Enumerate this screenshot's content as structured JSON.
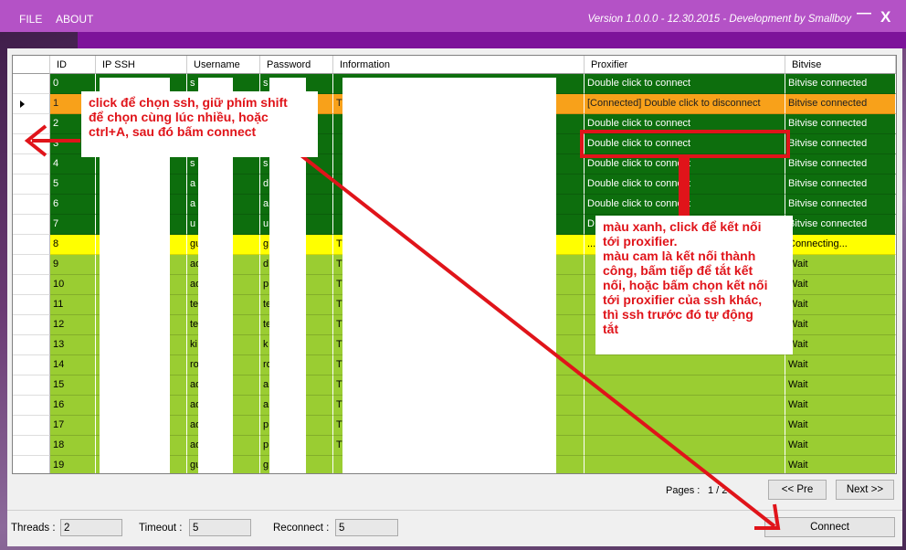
{
  "menu": {
    "file": "FILE",
    "about": "ABOUT"
  },
  "title": {
    "version": "Version 1.0.0.0 - 12.30.2015 - Development by Smallboy",
    "minimize": "—",
    "close": "X"
  },
  "grid": {
    "columns": [
      "ID",
      "IP SSH",
      "Username",
      "Password",
      "Information",
      "Proxifier",
      "Bitvise"
    ],
    "rows": [
      {
        "id": "0",
        "user": "s",
        "pass": "s",
        "info": "",
        "proxifier": "Double click to connect",
        "bitvise": "Bitvise connected",
        "color": "#0d6e0d",
        "fg": "#ffffff"
      },
      {
        "id": "1",
        "user": "",
        "pass": "",
        "info": "T",
        "proxifier": "[Connected] Double click to disconnect",
        "bitvise": "Bitvise connected",
        "color": "#f8a11a",
        "fg": "#202020"
      },
      {
        "id": "2",
        "user": "",
        "pass": "",
        "info": "",
        "proxifier": "Double click to connect",
        "bitvise": "Bitvise connected",
        "color": "#0d6e0d",
        "fg": "#ffffff"
      },
      {
        "id": "3",
        "user": "",
        "pass": "",
        "info": "",
        "proxifier": "Double click to connect",
        "bitvise": "Bitvise connected",
        "color": "#0d6e0d",
        "fg": "#ffffff"
      },
      {
        "id": "4",
        "user": "s",
        "pass": "s",
        "info": "",
        "proxifier": "Double click to connect",
        "bitvise": "Bitvise connected",
        "color": "#0d6e0d",
        "fg": "#ffffff"
      },
      {
        "id": "5",
        "user": "a",
        "pass": "d",
        "info": "",
        "proxifier": "Double click to connect",
        "bitvise": "Bitvise connected",
        "color": "#0d6e0d",
        "fg": "#ffffff"
      },
      {
        "id": "6",
        "user": "a",
        "pass": "a",
        "info": "",
        "proxifier": "Double click to connect",
        "bitvise": "Bitvise connected",
        "color": "#0d6e0d",
        "fg": "#ffffff"
      },
      {
        "id": "7",
        "user": "u",
        "pass": "u",
        "info": "",
        "proxifier": "D",
        "bitvise": "Bitvise connected",
        "color": "#0d6e0d",
        "fg": "#ffffff"
      },
      {
        "id": "8",
        "user": "gu",
        "pass": "g",
        "info": "T",
        "proxifier": "...",
        "bitvise": "Connecting...",
        "color": "#ffff00",
        "fg": "#000000"
      },
      {
        "id": "9",
        "user": "ad",
        "pass": "d",
        "info": "T",
        "proxifier": "",
        "bitvise": "Wait",
        "color": "#9acd32",
        "fg": "#000000"
      },
      {
        "id": "10",
        "user": "ad",
        "pass": "p",
        "info": "T",
        "proxifier": "",
        "bitvise": "Wait",
        "color": "#9acd32",
        "fg": "#000000"
      },
      {
        "id": "11",
        "user": "te",
        "pass": "te",
        "info": "T",
        "proxifier": "",
        "bitvise": "Wait",
        "color": "#9acd32",
        "fg": "#000000"
      },
      {
        "id": "12",
        "user": "te",
        "pass": "te",
        "info": "T",
        "proxifier": "",
        "bitvise": "Wait",
        "color": "#9acd32",
        "fg": "#000000"
      },
      {
        "id": "13",
        "user": "ki",
        "pass": "k",
        "info": "T",
        "proxifier": "",
        "bitvise": "Wait",
        "color": "#9acd32",
        "fg": "#000000"
      },
      {
        "id": "14",
        "user": "ro",
        "pass": "ro",
        "info": "T",
        "proxifier": "",
        "bitvise": "Wait",
        "color": "#9acd32",
        "fg": "#000000"
      },
      {
        "id": "15",
        "user": "ad",
        "pass": "a",
        "info": "T",
        "proxifier": "",
        "bitvise": "Wait",
        "color": "#9acd32",
        "fg": "#000000"
      },
      {
        "id": "16",
        "user": "ad",
        "pass": "a",
        "info": "T",
        "proxifier": "",
        "bitvise": "Wait",
        "color": "#9acd32",
        "fg": "#000000"
      },
      {
        "id": "17",
        "user": "ad",
        "pass": "p",
        "info": "T",
        "proxifier": "",
        "bitvise": "Wait",
        "color": "#9acd32",
        "fg": "#000000"
      },
      {
        "id": "18",
        "user": "ad",
        "pass": "p",
        "info": "T",
        "proxifier": "",
        "bitvise": "Wait",
        "color": "#9acd32",
        "fg": "#000000"
      },
      {
        "id": "19",
        "user": "gu",
        "pass": "g",
        "info": "",
        "proxifier": "",
        "bitvise": "Wait",
        "color": "#9acd32",
        "fg": "#000000"
      }
    ]
  },
  "paging": {
    "label": "Pages :",
    "value": "1 / 2",
    "prev": "<< Pre",
    "next": "Next >>"
  },
  "footer": {
    "threads_label": "Threads :",
    "threads_value": "2",
    "timeout_label": "Timeout :",
    "timeout_value": "5",
    "reconnect_label": "Reconnect :",
    "reconnect_value": "5",
    "connect": "Connect"
  },
  "annotations": {
    "left": "click để chọn ssh, giữ phím shift\nđể chọn cùng lúc nhiều, hoặc\nctrl+A, sau đó bấm connect",
    "right": "màu xanh, click để kết nối\ntới proxifier.\nmàu cam là kết nối thành\ncông, bấm tiếp để tắt kết\nnối, hoặc bấm chọn kết nối\ntới proxifier của ssh khác,\nthì ssh trước đó tự động\ntắt"
  },
  "colors": {
    "titlebar": "#b452c6",
    "strip": "#7d139a",
    "annotation": "#e0141a",
    "connected_green": "#0d6e0d",
    "connected_orange": "#f8a11a",
    "connecting_yellow": "#ffff00",
    "wait_green": "#9acd32"
  }
}
